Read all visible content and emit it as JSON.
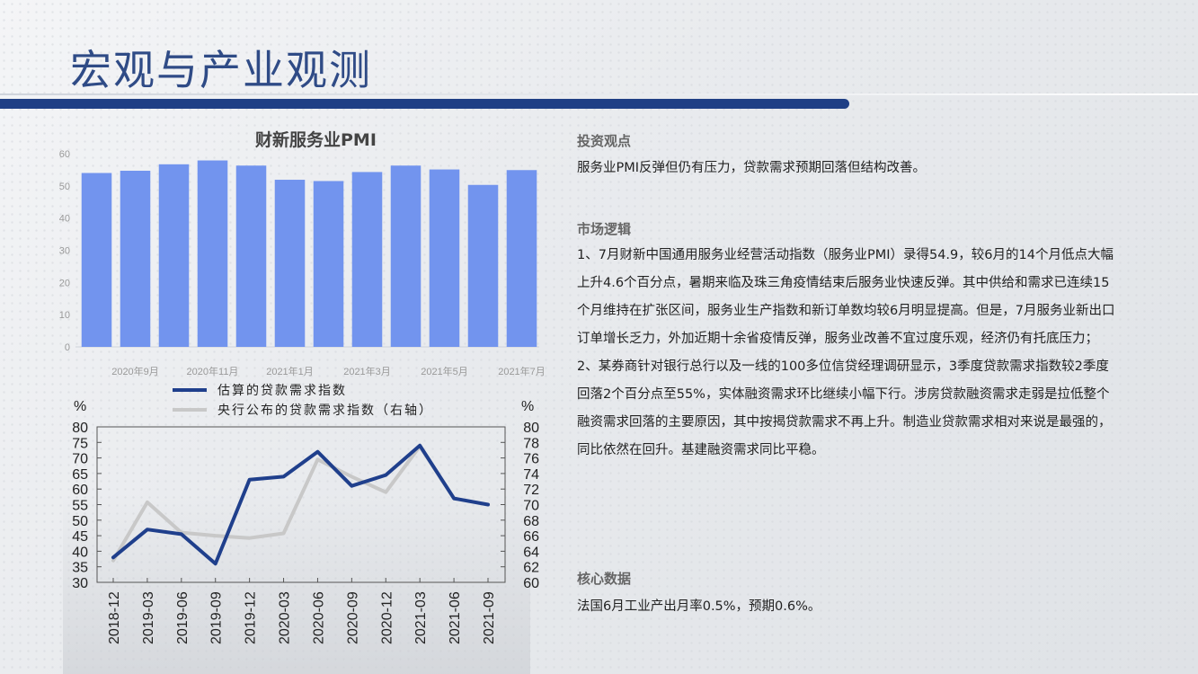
{
  "title": "宏观与产业观测",
  "right": {
    "investment_view": {
      "heading": "投资观点",
      "text": "服务业PMI反弹但仍有压力，贷款需求预期回落但结构改善。"
    },
    "market_logic": {
      "heading": "市场逻辑",
      "paragraphs": [
        "1、7月财新中国通用服务业经营活动指数（服务业PMI）录得54.9，较6月的14个月低点大幅上升4.6个百分点，暑期来临及珠三角疫情结束后服务业快速反弹。其中供给和需求已连续15个月维持在扩张区间，服务业生产指数和新订单数均较6月明显提高。但是，7月服务业新出口订单增长乏力，外加近期十余省疫情反弹，服务业改善不宜过度乐观，经济仍有托底压力；",
        "2、某券商针对银行总行以及一线的100多位信贷经理调研显示，3季度贷款需求指数较2季度回落2个百分点至55%，实体融资需求环比继续小幅下行。涉房贷款融资需求走弱是拉低整个融资需求回落的主要原因，其中按揭贷款需求不再上升。制造业贷款需求相对来说是最强的，同比依然在回升。基建融资需求同比平稳。"
      ]
    },
    "core_data": {
      "heading": "核心数据",
      "text": "法国6月工业产出月率0.5%，预期0.6%。"
    }
  },
  "chart_data": [
    {
      "type": "bar",
      "title": "财新服务业PMI",
      "color": "#7294ee",
      "ylim": [
        0,
        60
      ],
      "yticks": [
        "0",
        "10",
        "20",
        "30",
        "40",
        "50",
        "60"
      ],
      "x_tick_labels": [
        "2020年9月",
        "2020年11月",
        "2021年1月",
        "2021年3月",
        "2021年5月",
        "2021年7月"
      ],
      "values": [
        54.0,
        54.7,
        56.7,
        57.9,
        56.3,
        51.9,
        51.5,
        54.3,
        56.3,
        55.1,
        50.3,
        54.9
      ]
    },
    {
      "type": "line",
      "unit_left": "%",
      "unit_right": "%",
      "categories": [
        "2018-12",
        "2019-03",
        "2019-06",
        "2019-09",
        "2019-12",
        "2020-03",
        "2020-06",
        "2020-09",
        "2020-12",
        "2021-03",
        "2021-06",
        "2021-09"
      ],
      "yticks_left": [
        "30",
        "35",
        "40",
        "45",
        "50",
        "55",
        "60",
        "65",
        "70",
        "75",
        "80"
      ],
      "yticks_right": [
        "60",
        "62",
        "64",
        "66",
        "68",
        "70",
        "72",
        "74",
        "76",
        "78",
        "80"
      ],
      "ylim_left": [
        30,
        80
      ],
      "ylim_right": [
        60,
        80
      ],
      "series": [
        {
          "name": "估算的贷款需求指数",
          "axis": "left",
          "color": "#1f3f8c",
          "values": [
            38,
            47,
            45.5,
            36,
            63,
            64,
            72,
            61,
            64.5,
            74,
            57,
            55
          ]
        },
        {
          "name": "央行公布的贷款需求指数（右轴）",
          "axis": "right",
          "color": "#c8c8c8",
          "values": [
            62.8,
            70.3,
            66.4,
            66,
            65.7,
            66.3,
            75.8,
            73.6,
            71.6,
            77.5,
            70.8,
            null
          ]
        }
      ]
    }
  ]
}
